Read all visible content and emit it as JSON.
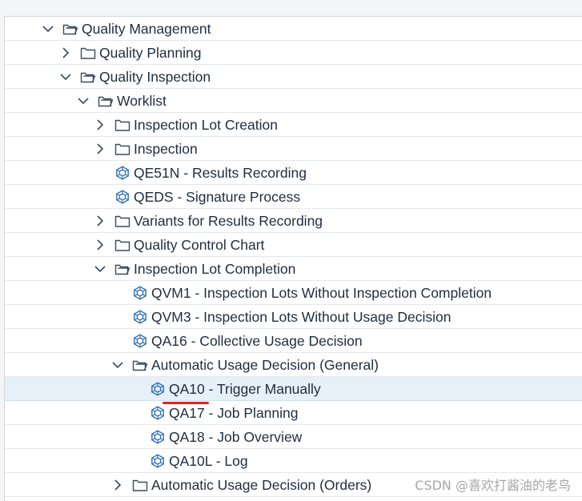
{
  "tree": {
    "items": [
      {
        "label": "Quality Management",
        "state": "expanded",
        "type": "folder"
      },
      {
        "label": "Quality Planning",
        "state": "collapsed",
        "type": "folder"
      },
      {
        "label": "Quality Inspection",
        "state": "expanded",
        "type": "folder"
      },
      {
        "label": "Worklist",
        "state": "expanded",
        "type": "folder"
      },
      {
        "label": "Inspection Lot Creation",
        "state": "collapsed",
        "type": "folder"
      },
      {
        "label": "Inspection",
        "state": "collapsed",
        "type": "folder"
      },
      {
        "label": "QE51N - Results Recording",
        "state": "leaf",
        "type": "transaction"
      },
      {
        "label": "QEDS - Signature Process",
        "state": "leaf",
        "type": "transaction"
      },
      {
        "label": "Variants for Results Recording",
        "state": "collapsed",
        "type": "folder"
      },
      {
        "label": "Quality Control Chart",
        "state": "collapsed",
        "type": "folder"
      },
      {
        "label": "Inspection Lot Completion",
        "state": "expanded",
        "type": "folder"
      },
      {
        "label": "QVM1 - Inspection Lots Without Inspection Completion",
        "state": "leaf",
        "type": "transaction"
      },
      {
        "label": "QVM3 - Inspection Lots Without Usage Decision",
        "state": "leaf",
        "type": "transaction"
      },
      {
        "label": "QA16 - Collective Usage Decision",
        "state": "leaf",
        "type": "transaction"
      },
      {
        "label": "Automatic Usage Decision (General)",
        "state": "expanded",
        "type": "folder"
      },
      {
        "label": "QA10 - Trigger Manually",
        "state": "leaf",
        "type": "transaction",
        "selected": true
      },
      {
        "label": "QA17 - Job Planning",
        "state": "leaf",
        "type": "transaction"
      },
      {
        "label": "QA18 - Job Overview",
        "state": "leaf",
        "type": "transaction"
      },
      {
        "label": "QA10L - Log",
        "state": "leaf",
        "type": "transaction"
      },
      {
        "label": "Automatic Usage Decision (Orders)",
        "state": "collapsed",
        "type": "folder"
      }
    ]
  },
  "annotation": {
    "color": "#e8201a",
    "style": "red underline under QA10"
  },
  "watermark": {
    "text": "CSDN @喜欢打酱油的老鸟"
  },
  "colors": {
    "text": "#1f2d3d",
    "icon": "#3a4b5c",
    "transaction_icon": "#2f6fb5",
    "selected_row": "#e6f0f9"
  }
}
